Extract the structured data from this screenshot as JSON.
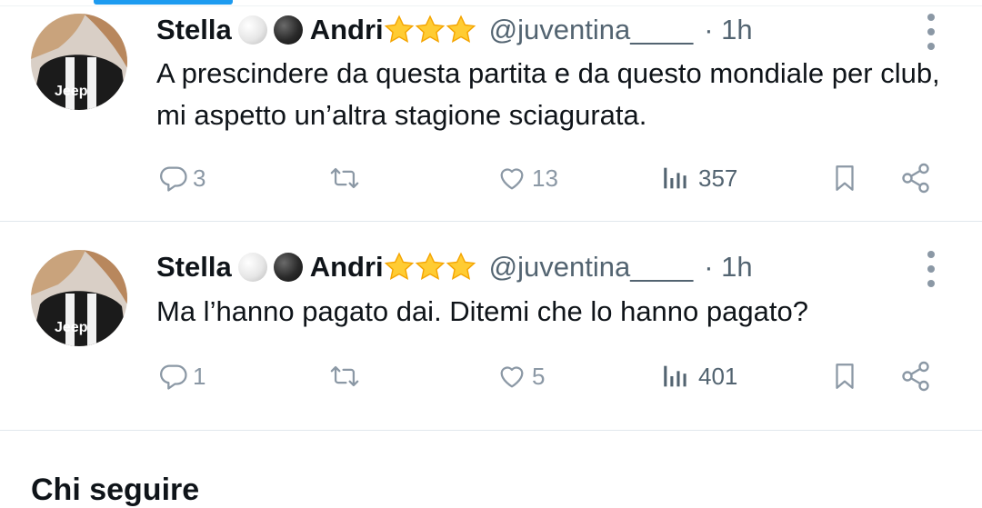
{
  "colors": {
    "accent": "#1d9bf0",
    "muted": "#8b98a5",
    "text": "#0f1419",
    "divider": "#e1e8ed"
  },
  "tweets": [
    {
      "name": "Stella",
      "name_suffix": "Andri",
      "name_emojis": [
        "white-circle",
        "black-circle",
        "star",
        "star",
        "star"
      ],
      "handle": "@juventina____",
      "time": "· 1h",
      "text": "A prescindere da questa partita e da questo mondiale per club, mi aspetto un’altra stagione sciagurata.",
      "replies": "3",
      "retweets": "",
      "likes": "13",
      "views": "357"
    },
    {
      "name": "Stella",
      "name_suffix": "Andri",
      "name_emojis": [
        "white-circle",
        "black-circle",
        "star",
        "star",
        "star"
      ],
      "handle": "@juventina____",
      "time": "· 1h",
      "text": "Ma l’hanno pagato dai. Ditemi che lo hanno pagato?",
      "replies": "1",
      "retweets": "",
      "likes": "5",
      "views": "401"
    }
  ],
  "sidebar_section": {
    "title": "Chi seguire"
  }
}
